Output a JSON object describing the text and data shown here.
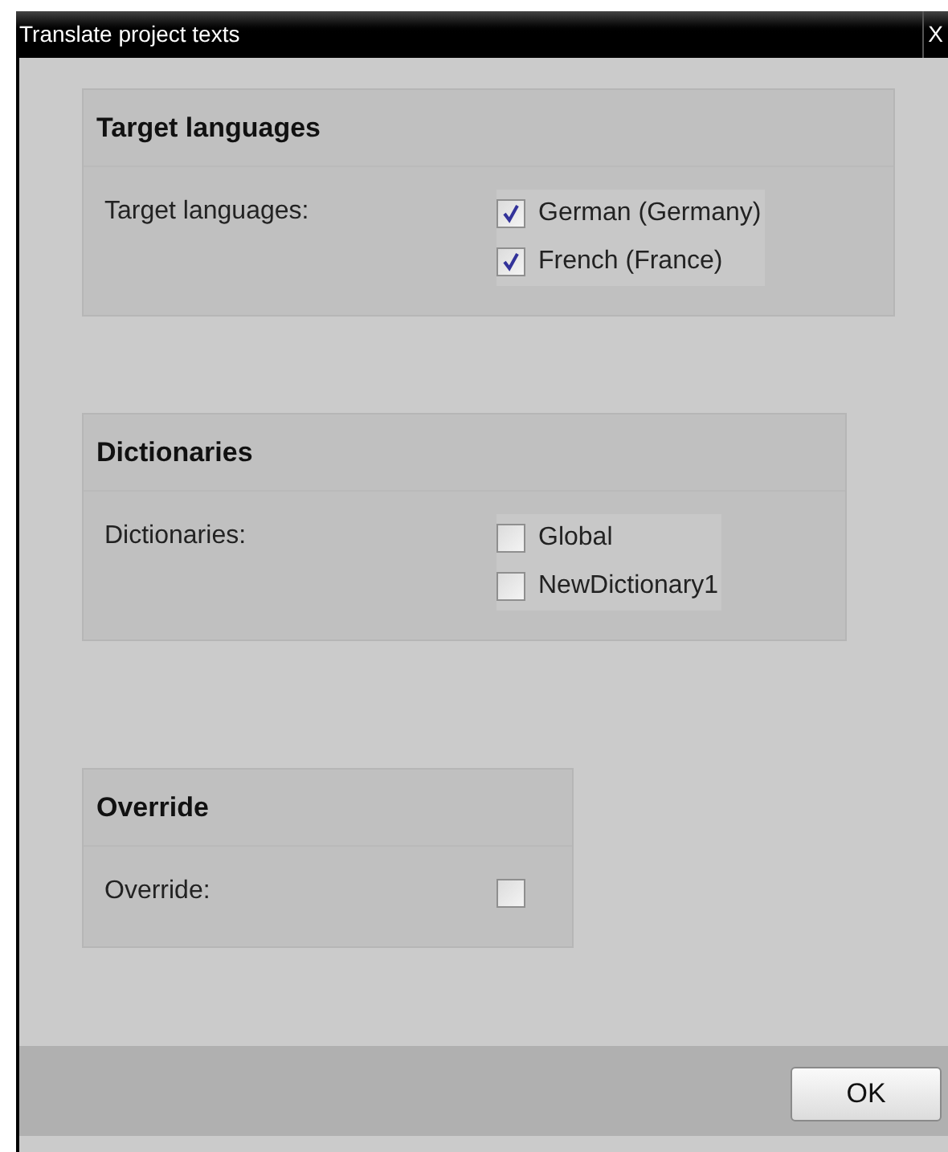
{
  "window": {
    "title": "Translate project texts",
    "close": "X"
  },
  "sections": [
    {
      "title": "Target languages",
      "label": "Target languages:",
      "kind": "list",
      "options": [
        {
          "label": "German (Germany)",
          "checked": true
        },
        {
          "label": "French (France)",
          "checked": true
        }
      ]
    },
    {
      "title": "Dictionaries",
      "label": "Dictionaries:",
      "kind": "list",
      "options": [
        {
          "label": "Global",
          "checked": false
        },
        {
          "label": "NewDictionary1",
          "checked": false
        }
      ]
    },
    {
      "title": "Override",
      "label": "Override:",
      "kind": "single",
      "options": [
        {
          "checked": false
        }
      ]
    }
  ],
  "buttons": [
    "OK"
  ]
}
